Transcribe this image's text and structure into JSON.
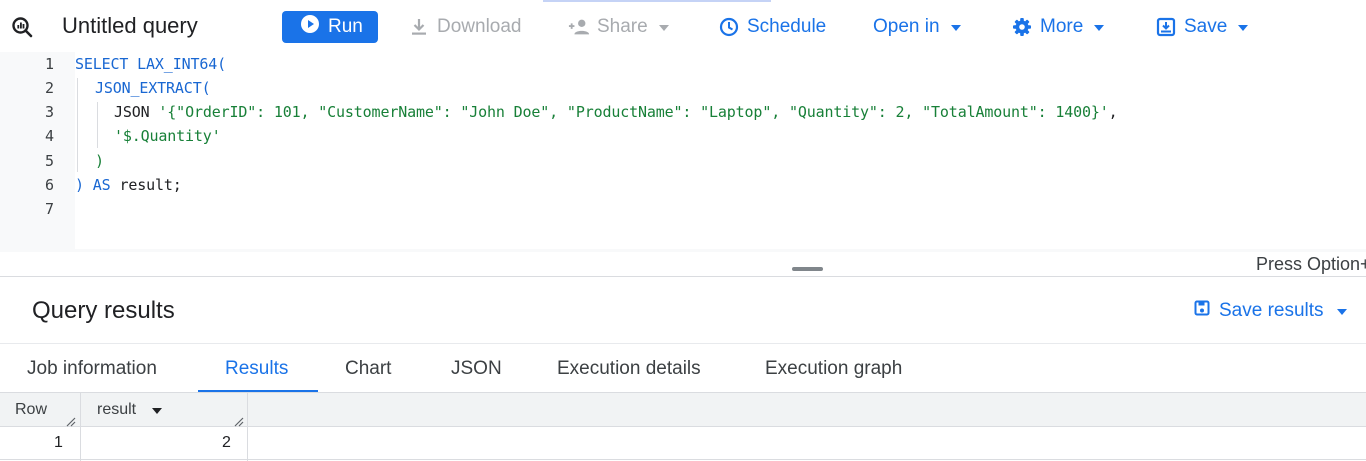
{
  "toolbar": {
    "title": "Untitled query",
    "run_label": "Run",
    "download_label": "Download",
    "share_label": "Share",
    "schedule_label": "Schedule",
    "open_in_label": "Open in",
    "more_label": "More",
    "save_label": "Save"
  },
  "editor": {
    "line_numbers": [
      "1",
      "2",
      "3",
      "4",
      "5",
      "6",
      "7"
    ],
    "l1_kw": "SELECT LAX_INT64(",
    "l2_kw": "JSON_EXTRACT(",
    "l3_kw": "JSON",
    "l3_str": "'{\"OrderID\": 101, \"CustomerName\": \"John Doe\", \"ProductName\": \"Laptop\", \"Quantity\": 2, \"TotalAmount\": 1400}'",
    "l3_tail": ",",
    "l4_str": "'$.Quantity'",
    "l5_paren": ")",
    "l6_paren": ")",
    "l6_as": "AS",
    "l6_tail": "result;",
    "hint": "Press Option+"
  },
  "results": {
    "title": "Query results",
    "save_results_label": "Save results",
    "tabs": [
      "Job information",
      "Results",
      "Chart",
      "JSON",
      "Execution details",
      "Execution graph"
    ],
    "active_tab": "Results",
    "columns": [
      "Row",
      "result"
    ],
    "rows": [
      [
        "1",
        "2"
      ]
    ]
  },
  "colors": {
    "accent": "#1a73e8",
    "keyword": "#1967d2",
    "string": "#188038"
  }
}
